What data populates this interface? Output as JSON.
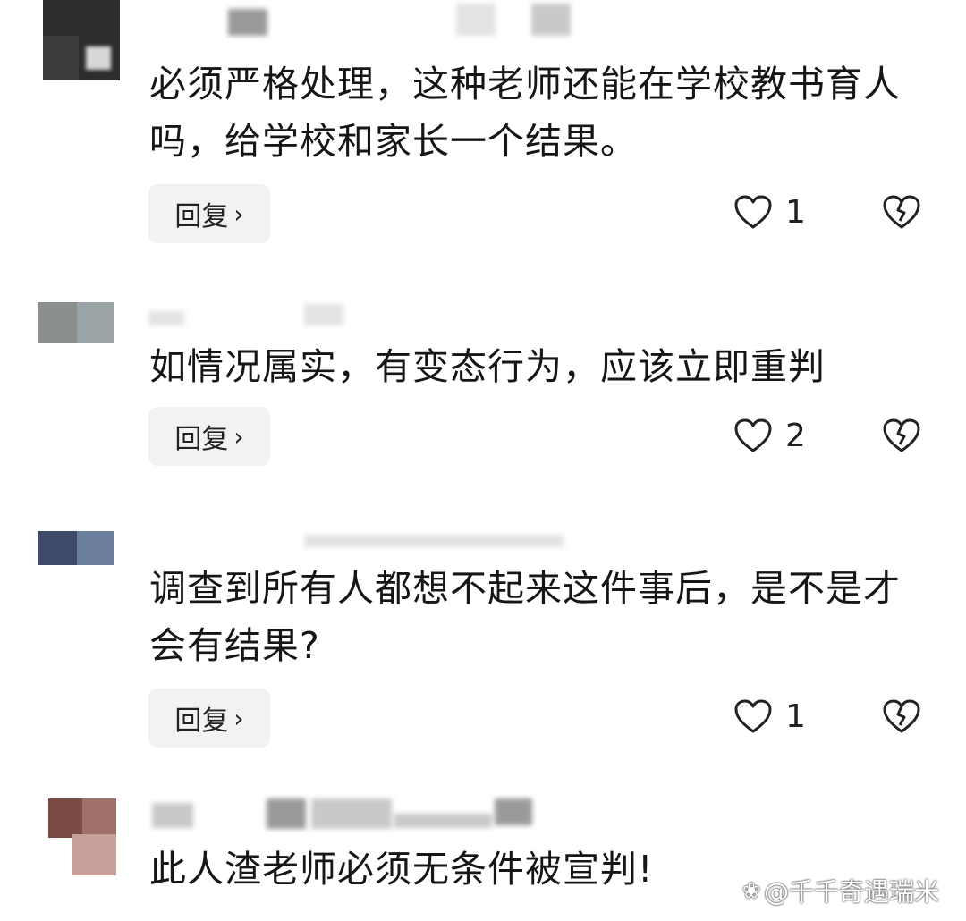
{
  "comments": [
    {
      "text": "必须严格处理，这种老师还能在学校教书育人吗，给学校和家长一个结果。",
      "reply_label": "回复",
      "likes": "1"
    },
    {
      "text": "如情况属实，有变态行为，应该立即重判",
      "reply_label": "回复",
      "likes": "2"
    },
    {
      "text": "调查到所有人都想不起来这件事后，是不是才会有结果?",
      "reply_label": "回复",
      "likes": "1"
    },
    {
      "text": "此人渣老师必须无条件被宣判!"
    }
  ],
  "watermark": "@千千奇遇瑞米",
  "icons": {
    "like": "heart-outline-icon",
    "dislike": "broken-heart-icon",
    "reply_chevron": "chevron-right-icon",
    "watermark": "paw-icon"
  },
  "colors": {
    "text": "#161616",
    "reply_bg": "#f2f2f2",
    "background": "#ffffff"
  }
}
